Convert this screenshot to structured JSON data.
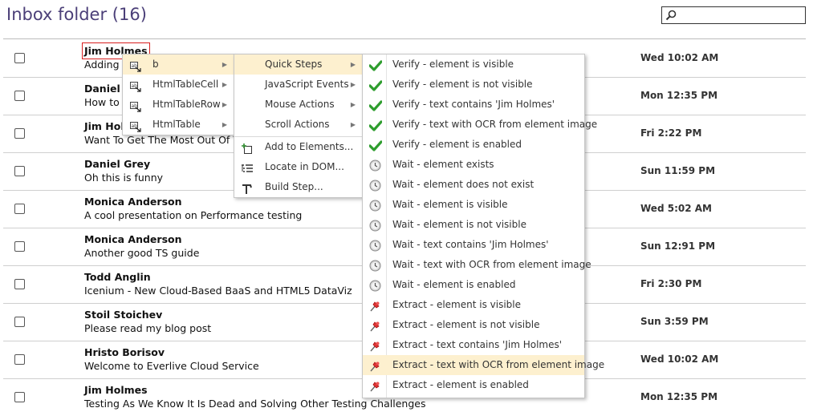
{
  "page": {
    "title": "Inbox folder (16)",
    "search_value": ""
  },
  "emails": [
    {
      "sender": "Jim Holmes",
      "subject": "Adding W",
      "date": "Wed 10:02 AM"
    },
    {
      "sender": "Daniel G",
      "subject": "How to l",
      "date": "Mon 12:35 PM"
    },
    {
      "sender": "Jim Holm",
      "subject": "Want To Get The Most Out Of Yo",
      "date": "Fri 2:22 PM"
    },
    {
      "sender": "Daniel Grey",
      "subject": "Oh this is funny",
      "date": "Sun 11:59 PM"
    },
    {
      "sender": "Monica Anderson",
      "subject": "A cool presentation on Performance testing",
      "date": "Wed 5:02 AM"
    },
    {
      "sender": "Monica Anderson",
      "subject": "Another good TS guide",
      "date": "Sun 12:91 PM"
    },
    {
      "sender": "Todd Anglin",
      "subject": "Icenium - New Cloud-Based BaaS and HTML5 DataViz",
      "date": "Fri 2:30 PM"
    },
    {
      "sender": "Stoil Stoichev",
      "subject": "Please read my blog post",
      "date": "Sun 3:59 PM"
    },
    {
      "sender": "Hristo Borisov",
      "subject": "Welcome to Everlive Cloud Service",
      "date": "Wed 10:02 AM"
    },
    {
      "sender": "Jim Holmes",
      "subject": "Testing As We Know It Is Dead and Solving Other Testing Challenges",
      "date": "Mon 12:35 PM"
    }
  ],
  "menu_elements": [
    {
      "label": "b",
      "icon": "element-icon"
    },
    {
      "label": "HtmlTableCell",
      "icon": "element-icon"
    },
    {
      "label": "HtmlTableRow",
      "icon": "element-icon"
    },
    {
      "label": "HtmlTable",
      "icon": "element-icon"
    }
  ],
  "menu_actions": {
    "submenus": [
      "Quick Steps",
      "JavaScript Events",
      "Mouse Actions",
      "Scroll Actions"
    ],
    "commands": [
      {
        "label": "Add to Elements...",
        "icon": "add-elements-icon"
      },
      {
        "label": "Locate in DOM...",
        "icon": "locate-dom-icon"
      },
      {
        "label": "Build Step...",
        "icon": "build-step-icon"
      }
    ]
  },
  "menu_quick_steps": [
    {
      "label": "Verify - element is visible",
      "icon": "check-icon"
    },
    {
      "label": "Verify - element is not visible",
      "icon": "check-icon"
    },
    {
      "label": "Verify - text contains 'Jim Holmes'",
      "icon": "check-icon"
    },
    {
      "label": "Verify - text with OCR from element image",
      "icon": "check-icon"
    },
    {
      "label": "Verify - element is enabled",
      "icon": "check-icon"
    },
    {
      "label": "Wait - element exists",
      "icon": "clock-icon"
    },
    {
      "label": "Wait - element does not exist",
      "icon": "clock-icon"
    },
    {
      "label": "Wait - element is visible",
      "icon": "clock-icon"
    },
    {
      "label": "Wait - element is not visible",
      "icon": "clock-icon"
    },
    {
      "label": "Wait - text contains 'Jim Holmes'",
      "icon": "clock-icon"
    },
    {
      "label": "Wait - text with OCR from element image",
      "icon": "clock-icon"
    },
    {
      "label": "Wait - element is enabled",
      "icon": "clock-icon"
    },
    {
      "label": "Extract - element is visible",
      "icon": "pin-icon"
    },
    {
      "label": "Extract - element is not visible",
      "icon": "pin-icon"
    },
    {
      "label": "Extract - text contains 'Jim Holmes'",
      "icon": "pin-icon"
    },
    {
      "label": "Extract - text with OCR from element image",
      "icon": "pin-icon"
    },
    {
      "label": "Extract - element is enabled",
      "icon": "pin-icon"
    }
  ],
  "colors": {
    "title": "#4b3f78",
    "highlight_row": "#fdf0cf",
    "selection_border": "#d81f1f",
    "check": "#2e9d2e"
  }
}
